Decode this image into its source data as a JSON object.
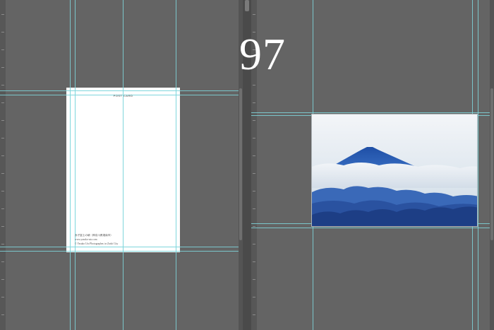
{
  "app": {
    "theme": "dark-gray workspace"
  },
  "spread": {
    "page_number": "97"
  },
  "left_page": {
    "postcard": {
      "title": "POST CARD",
      "credit_line_1": "赤子富士の朝（神奈川県湘南市）",
      "credit_line_2": "www.yasuko-uto.com",
      "credit_line_3": "© Yasuko Uto Photographer, in Zushi City"
    }
  },
  "right_page": {
    "photo": {
      "subject": "mount-fuji-above-clouds",
      "sky_color": "#e8edf2",
      "mountain_color": "#2d62b3",
      "foreground_color": "#1f3f86"
    }
  },
  "colors": {
    "guide": "#7fd6dc",
    "background": "#646464",
    "page": "#ffffff"
  }
}
